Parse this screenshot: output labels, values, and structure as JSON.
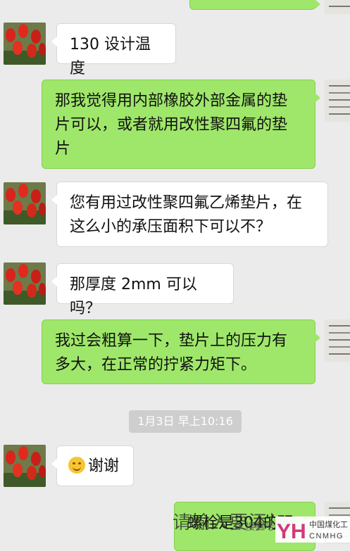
{
  "messages": [
    {
      "side": "out",
      "text": ""
    },
    {
      "side": "in",
      "text": "130 设计温度"
    },
    {
      "side": "out",
      "text": "那我觉得用内部橡胶外部金属的垫片可以，或者就用改性聚四氟的垫片"
    },
    {
      "side": "in",
      "text": "您有用过改性聚四氟乙烯垫片，在这么小的承压面积下可以不？"
    },
    {
      "side": "in",
      "text": "那厚度 2mm 可以吗？"
    },
    {
      "side": "out",
      "text": "我过会粗算一下，垫片上的压力有多大，在正常的拧紧力矩下。"
    },
    {
      "side": "in",
      "text": "谢谢",
      "emoji": "smile-emoji"
    },
    {
      "side": "out",
      "text": "螺栓是304的吗"
    }
  ],
  "timestamp": "1月3日 早上10:16",
  "watermark": {
    "overlay_text": "请输入要添加",
    "sub_text": "搜狐号",
    "logo_letters": "YH",
    "logo_cn": "中国煤化工",
    "logo_en": "CNMHG"
  },
  "colors": {
    "background": "#ebebeb",
    "outgoing_bubble": "#9fe76a",
    "incoming_bubble": "#ffffff",
    "timestamp_bg": "#cecece"
  }
}
